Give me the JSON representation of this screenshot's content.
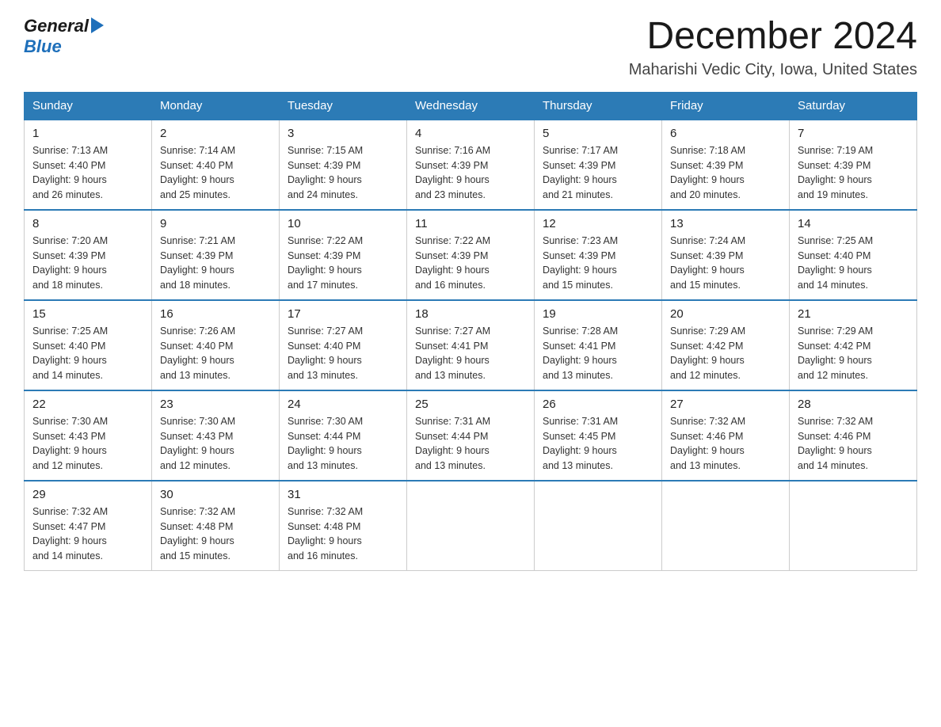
{
  "header": {
    "logo_general": "General",
    "logo_blue": "Blue",
    "month_title": "December 2024",
    "location": "Maharishi Vedic City, Iowa, United States"
  },
  "weekdays": [
    "Sunday",
    "Monday",
    "Tuesday",
    "Wednesday",
    "Thursday",
    "Friday",
    "Saturday"
  ],
  "weeks": [
    [
      {
        "day": "1",
        "sunrise": "7:13 AM",
        "sunset": "4:40 PM",
        "daylight": "9 hours and 26 minutes."
      },
      {
        "day": "2",
        "sunrise": "7:14 AM",
        "sunset": "4:40 PM",
        "daylight": "9 hours and 25 minutes."
      },
      {
        "day": "3",
        "sunrise": "7:15 AM",
        "sunset": "4:39 PM",
        "daylight": "9 hours and 24 minutes."
      },
      {
        "day": "4",
        "sunrise": "7:16 AM",
        "sunset": "4:39 PM",
        "daylight": "9 hours and 23 minutes."
      },
      {
        "day": "5",
        "sunrise": "7:17 AM",
        "sunset": "4:39 PM",
        "daylight": "9 hours and 21 minutes."
      },
      {
        "day": "6",
        "sunrise": "7:18 AM",
        "sunset": "4:39 PM",
        "daylight": "9 hours and 20 minutes."
      },
      {
        "day": "7",
        "sunrise": "7:19 AM",
        "sunset": "4:39 PM",
        "daylight": "9 hours and 19 minutes."
      }
    ],
    [
      {
        "day": "8",
        "sunrise": "7:20 AM",
        "sunset": "4:39 PM",
        "daylight": "9 hours and 18 minutes."
      },
      {
        "day": "9",
        "sunrise": "7:21 AM",
        "sunset": "4:39 PM",
        "daylight": "9 hours and 18 minutes."
      },
      {
        "day": "10",
        "sunrise": "7:22 AM",
        "sunset": "4:39 PM",
        "daylight": "9 hours and 17 minutes."
      },
      {
        "day": "11",
        "sunrise": "7:22 AM",
        "sunset": "4:39 PM",
        "daylight": "9 hours and 16 minutes."
      },
      {
        "day": "12",
        "sunrise": "7:23 AM",
        "sunset": "4:39 PM",
        "daylight": "9 hours and 15 minutes."
      },
      {
        "day": "13",
        "sunrise": "7:24 AM",
        "sunset": "4:39 PM",
        "daylight": "9 hours and 15 minutes."
      },
      {
        "day": "14",
        "sunrise": "7:25 AM",
        "sunset": "4:40 PM",
        "daylight": "9 hours and 14 minutes."
      }
    ],
    [
      {
        "day": "15",
        "sunrise": "7:25 AM",
        "sunset": "4:40 PM",
        "daylight": "9 hours and 14 minutes."
      },
      {
        "day": "16",
        "sunrise": "7:26 AM",
        "sunset": "4:40 PM",
        "daylight": "9 hours and 13 minutes."
      },
      {
        "day": "17",
        "sunrise": "7:27 AM",
        "sunset": "4:40 PM",
        "daylight": "9 hours and 13 minutes."
      },
      {
        "day": "18",
        "sunrise": "7:27 AM",
        "sunset": "4:41 PM",
        "daylight": "9 hours and 13 minutes."
      },
      {
        "day": "19",
        "sunrise": "7:28 AM",
        "sunset": "4:41 PM",
        "daylight": "9 hours and 13 minutes."
      },
      {
        "day": "20",
        "sunrise": "7:29 AM",
        "sunset": "4:42 PM",
        "daylight": "9 hours and 12 minutes."
      },
      {
        "day": "21",
        "sunrise": "7:29 AM",
        "sunset": "4:42 PM",
        "daylight": "9 hours and 12 minutes."
      }
    ],
    [
      {
        "day": "22",
        "sunrise": "7:30 AM",
        "sunset": "4:43 PM",
        "daylight": "9 hours and 12 minutes."
      },
      {
        "day": "23",
        "sunrise": "7:30 AM",
        "sunset": "4:43 PM",
        "daylight": "9 hours and 12 minutes."
      },
      {
        "day": "24",
        "sunrise": "7:30 AM",
        "sunset": "4:44 PM",
        "daylight": "9 hours and 13 minutes."
      },
      {
        "day": "25",
        "sunrise": "7:31 AM",
        "sunset": "4:44 PM",
        "daylight": "9 hours and 13 minutes."
      },
      {
        "day": "26",
        "sunrise": "7:31 AM",
        "sunset": "4:45 PM",
        "daylight": "9 hours and 13 minutes."
      },
      {
        "day": "27",
        "sunrise": "7:32 AM",
        "sunset": "4:46 PM",
        "daylight": "9 hours and 13 minutes."
      },
      {
        "day": "28",
        "sunrise": "7:32 AM",
        "sunset": "4:46 PM",
        "daylight": "9 hours and 14 minutes."
      }
    ],
    [
      {
        "day": "29",
        "sunrise": "7:32 AM",
        "sunset": "4:47 PM",
        "daylight": "9 hours and 14 minutes."
      },
      {
        "day": "30",
        "sunrise": "7:32 AM",
        "sunset": "4:48 PM",
        "daylight": "9 hours and 15 minutes."
      },
      {
        "day": "31",
        "sunrise": "7:32 AM",
        "sunset": "4:48 PM",
        "daylight": "9 hours and 16 minutes."
      },
      null,
      null,
      null,
      null
    ]
  ],
  "labels": {
    "sunrise": "Sunrise:",
    "sunset": "Sunset:",
    "daylight": "Daylight:"
  }
}
